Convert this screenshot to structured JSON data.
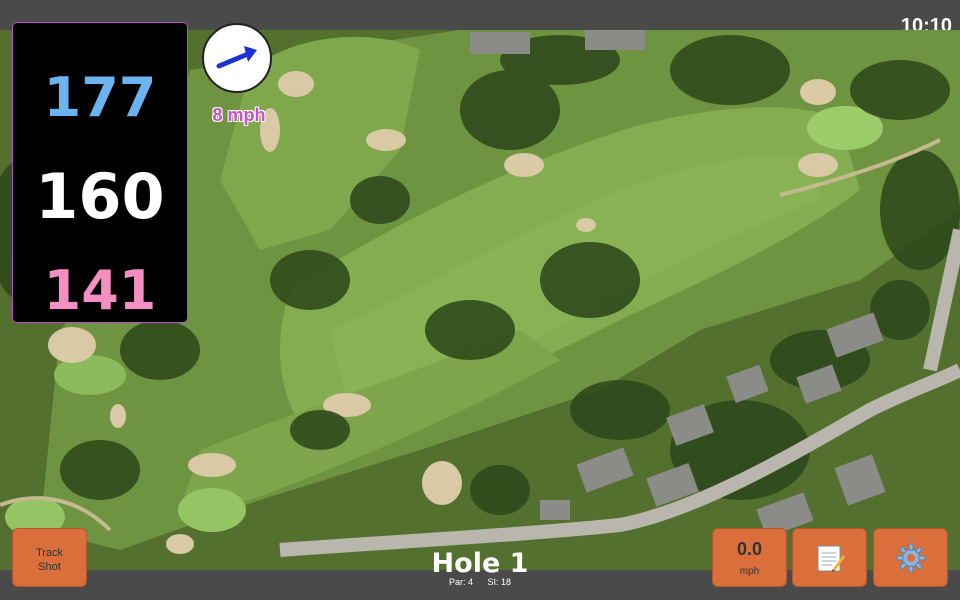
{
  "status": {
    "time": "10:10"
  },
  "distances": {
    "back": "177",
    "center": "160",
    "front": "141"
  },
  "wind": {
    "speed": "8 mph",
    "direction_icon": "wind-arrow-icon"
  },
  "hole": {
    "title": "Hole 1",
    "par": "Par: 4",
    "stroke_index": "SI: 18"
  },
  "buttons": {
    "track_shot_line1": "Track",
    "track_shot_line2": "Shot",
    "speed_value": "0.0",
    "speed_unit": "mph",
    "notes_icon": "notepad-icon",
    "settings_icon": "gear-icon"
  },
  "colors": {
    "back_distance": "#6cb4f0",
    "center_distance": "#ffffff",
    "front_distance": "#f48fc1",
    "button": "#db6f3c",
    "wind_arrow": "#1a2fd6"
  }
}
